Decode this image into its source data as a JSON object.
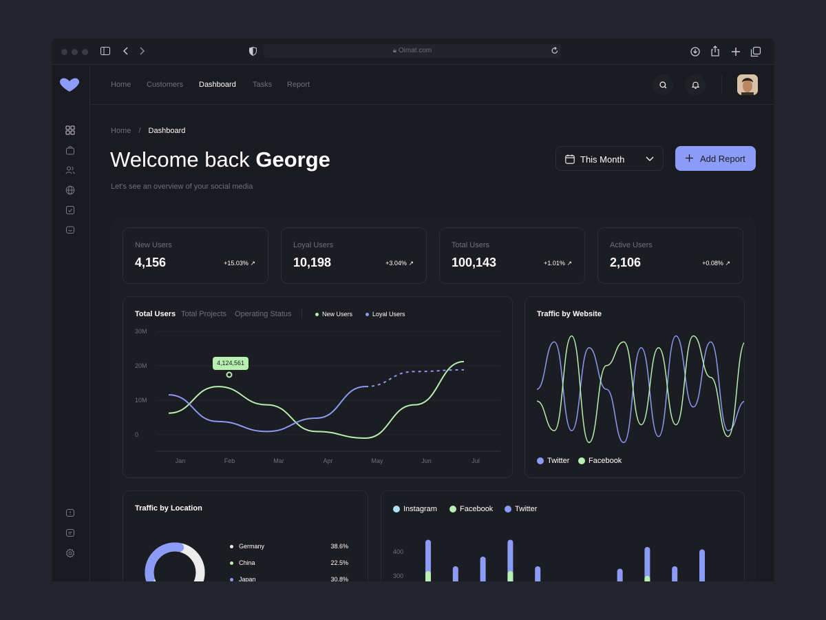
{
  "browser": {
    "url": "Oimat.com"
  },
  "nav": {
    "items": [
      "Home",
      "Customers",
      "Dashboard",
      "Tasks",
      "Report"
    ]
  },
  "breadcrumb": {
    "home": "Home",
    "sep": "/",
    "current": "Dashboard"
  },
  "welcome": {
    "greeting": "Welcome back",
    "name": "George",
    "subtitle": "Let's see an overview of your social media"
  },
  "filters": {
    "period": "This Month",
    "add_label": "Add Report"
  },
  "stats": [
    {
      "title": "New Users",
      "value": "4,156",
      "change": "+15.03%"
    },
    {
      "title": "Loyal Users",
      "value": "10,198",
      "change": "+3.04%"
    },
    {
      "title": "Total Users",
      "value": "100,143",
      "change": "+1.01%"
    },
    {
      "title": "Active Users",
      "value": "2,106",
      "change": "+0.08%"
    }
  ],
  "colors": {
    "green": "#b7f0b1",
    "purple": "#8c9bf5",
    "cyan": "#a9e1f5",
    "white": "#ececec"
  },
  "users_chart": {
    "tabs": [
      "Total Users",
      "Total Projects",
      "Operating Status"
    ],
    "legend": [
      "New Users",
      "Loyal Users"
    ],
    "tooltip": "4,124,561"
  },
  "website_chart": {
    "title": "Traffic by Website",
    "legend": [
      "Twitter",
      "Facebook"
    ]
  },
  "location_chart": {
    "title": "Traffic by Location",
    "rows": [
      {
        "country": "Germany",
        "pct": "38.6%",
        "color": "#ececec"
      },
      {
        "country": "China",
        "pct": "22.5%",
        "color": "#b7f0b1"
      },
      {
        "country": "Japan",
        "pct": "30.8%",
        "color": "#8c9bf5"
      }
    ]
  },
  "social_chart": {
    "legend": [
      "Instagram",
      "Facebook",
      "Twitter"
    ]
  },
  "chart_data": [
    {
      "type": "line",
      "x": [
        "Jan",
        "Feb",
        "Mar",
        "Apr",
        "May",
        "Jun",
        "Jul"
      ],
      "yticks": [
        "30M",
        "20M",
        "10M",
        "0"
      ],
      "ylim": [
        0,
        30
      ],
      "series": [
        {
          "name": "New Users",
          "values": [
            7.5,
            15.5,
            10,
            2,
            0,
            10,
            23
          ]
        },
        {
          "name": "Loyal Users",
          "values": [
            13,
            5,
            2,
            6,
            15.5,
            20,
            20.5
          ]
        }
      ],
      "grid": true,
      "legend_position": "top"
    },
    {
      "type": "line",
      "title": "Traffic by Website",
      "series": [
        {
          "name": "Twitter",
          "values": [
            0.5,
            0.9,
            0.15,
            0.85,
            0.5,
            0.05,
            0.85,
            0.1,
            0.95,
            0.35,
            0.9,
            0.15,
            0.4
          ]
        },
        {
          "name": "Facebook",
          "values": [
            0.4,
            0.15,
            0.95,
            0.05,
            0.7,
            0.9,
            0.2,
            0.85,
            0.2,
            0.95,
            0.6,
            0.1,
            0.9
          ]
        }
      ]
    },
    {
      "type": "pie",
      "title": "Traffic by Location",
      "categories": [
        "Germany",
        "China",
        "Japan"
      ],
      "values": [
        38.6,
        22.5,
        30.8
      ]
    },
    {
      "type": "bar",
      "yticks": [
        "400",
        "300"
      ],
      "series": [
        {
          "name": "Instagram",
          "values": [
            430,
            340,
            370,
            430,
            340,
            0,
            0,
            330,
            410,
            340,
            400,
            0,
            440
          ]
        },
        {
          "name": "Facebook",
          "values": [
            320,
            0,
            0,
            320,
            0,
            0,
            0,
            0,
            300,
            0,
            0,
            0,
            380
          ]
        },
        {
          "name": "Twitter",
          "values": [
            450,
            340,
            380,
            450,
            340,
            0,
            0,
            330,
            420,
            340,
            410,
            0,
            500
          ]
        }
      ]
    }
  ]
}
